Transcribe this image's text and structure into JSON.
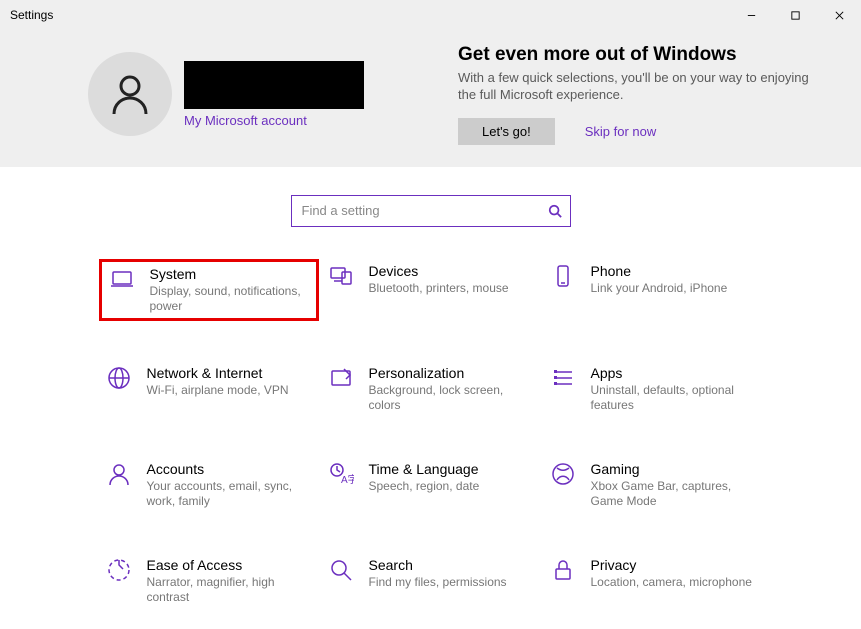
{
  "window": {
    "title": "Settings"
  },
  "profile": {
    "account_link": "My Microsoft account"
  },
  "promo": {
    "heading": "Get even more out of Windows",
    "body": "With a few quick selections, you'll be on your way to enjoying the full Microsoft experience.",
    "button": "Let's go!",
    "skip": "Skip for now"
  },
  "search": {
    "placeholder": "Find a setting"
  },
  "tiles": {
    "system": {
      "label": "System",
      "sub": "Display, sound, notifications, power"
    },
    "devices": {
      "label": "Devices",
      "sub": "Bluetooth, printers, mouse"
    },
    "phone": {
      "label": "Phone",
      "sub": "Link your Android, iPhone"
    },
    "network": {
      "label": "Network & Internet",
      "sub": "Wi-Fi, airplane mode, VPN"
    },
    "personal": {
      "label": "Personalization",
      "sub": "Background, lock screen, colors"
    },
    "apps": {
      "label": "Apps",
      "sub": "Uninstall, defaults, optional features"
    },
    "accounts": {
      "label": "Accounts",
      "sub": "Your accounts, email, sync, work, family"
    },
    "time": {
      "label": "Time & Language",
      "sub": "Speech, region, date"
    },
    "gaming": {
      "label": "Gaming",
      "sub": "Xbox Game Bar, captures, Game Mode"
    },
    "ease": {
      "label": "Ease of Access",
      "sub": "Narrator, magnifier, high contrast"
    },
    "searchcat": {
      "label": "Search",
      "sub": "Find my files, permissions"
    },
    "privacy": {
      "label": "Privacy",
      "sub": "Location, camera, microphone"
    }
  }
}
